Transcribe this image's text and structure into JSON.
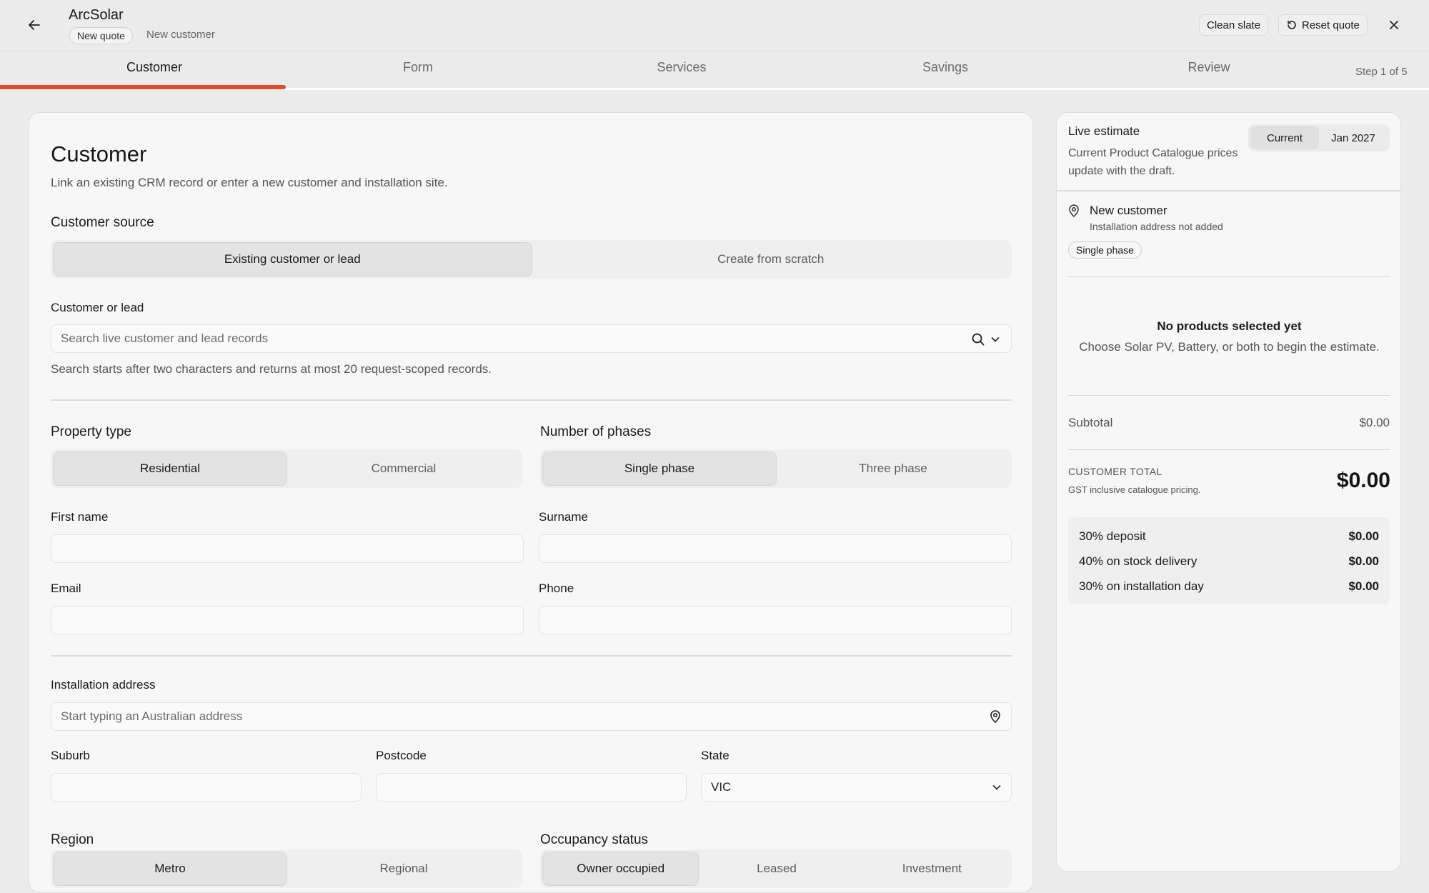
{
  "header": {
    "app_title": "ArcSolar",
    "badge": "New quote",
    "subtitle": "New customer",
    "clean_slate": "Clean slate",
    "reset_quote": "Reset quote"
  },
  "tabs": [
    {
      "label": "Customer",
      "active": true
    },
    {
      "label": "Form"
    },
    {
      "label": "Services"
    },
    {
      "label": "Savings"
    },
    {
      "label": "Review"
    }
  ],
  "step_label": "Step 1 of 5",
  "main": {
    "title": "Customer",
    "lead": "Link an existing CRM record or enter a new customer and installation site.",
    "customer_source": {
      "label": "Customer source",
      "options": [
        "Existing customer or lead",
        "Create from scratch"
      ],
      "selected": "Existing customer or lead"
    },
    "customer_or_lead": {
      "label": "Customer or lead",
      "placeholder": "Search live customer and lead records",
      "hint": "Search starts after two characters and returns at most 20 request-scoped records."
    },
    "property_type": {
      "label": "Property type",
      "options": [
        "Residential",
        "Commercial"
      ],
      "selected": "Residential"
    },
    "phases": {
      "label": "Number of phases",
      "options": [
        "Single phase",
        "Three phase"
      ],
      "selected": "Single phase"
    },
    "first_name": {
      "label": "First name",
      "value": ""
    },
    "surname": {
      "label": "Surname",
      "value": ""
    },
    "email": {
      "label": "Email",
      "value": ""
    },
    "phone": {
      "label": "Phone",
      "value": ""
    },
    "installation_address": {
      "label": "Installation address",
      "placeholder": "Start typing an Australian address"
    },
    "suburb": {
      "label": "Suburb",
      "value": ""
    },
    "postcode": {
      "label": "Postcode",
      "value": ""
    },
    "state": {
      "label": "State",
      "value": "VIC"
    },
    "region": {
      "label": "Region",
      "options": [
        "Metro",
        "Regional"
      ],
      "selected": "Metro"
    },
    "occupancy": {
      "label": "Occupancy status",
      "options": [
        "Owner occupied",
        "Leased",
        "Investment"
      ],
      "selected": "Owner occupied"
    }
  },
  "estimate": {
    "title": "Live estimate",
    "subtitle": "Current Product Catalogue prices update with the draft.",
    "toggle": [
      "Current",
      "Jan 2027"
    ],
    "toggle_selected": "Current",
    "customer_name": "New customer",
    "address_status": "Installation address not added",
    "phase_badge": "Single phase",
    "empty_title": "No products selected yet",
    "empty_sub": "Choose Solar PV, Battery, or both to begin the estimate.",
    "subtotal_label": "Subtotal",
    "subtotal_value": "$0.00",
    "total_label": "CUSTOMER TOTAL",
    "total_note": "GST inclusive catalogue pricing.",
    "total_value": "$0.00",
    "payments": [
      {
        "label": "30% deposit",
        "amount": "$0.00"
      },
      {
        "label": "40% on stock delivery",
        "amount": "$0.00"
      },
      {
        "label": "30% on installation day",
        "amount": "$0.00"
      }
    ]
  },
  "colors": {
    "accent": "#e24c2b",
    "background": "#ebebeb",
    "card": "#f7f7f7"
  }
}
